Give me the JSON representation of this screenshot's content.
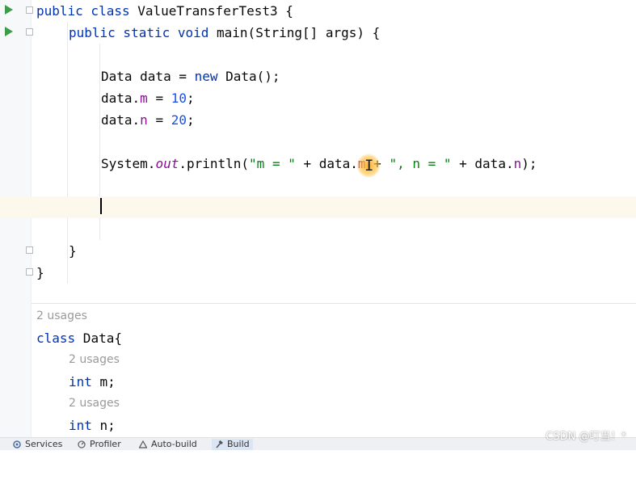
{
  "editor": {
    "lines": {
      "l1": {
        "kw": "public class",
        "name": " ValueTransferTest3 {"
      },
      "l2": {
        "kw1": "public static void",
        "name": " main(String[] args) {"
      },
      "l4": {
        "type": "Data data = ",
        "kw": "new",
        "rest": " Data();"
      },
      "l5": {
        "obj": "data.",
        "field": "m",
        "eq": " = ",
        "num": "10",
        "end": ";"
      },
      "l6": {
        "obj": "data.",
        "field": "n",
        "eq": " = ",
        "num": "20",
        "end": ";"
      },
      "l8": {
        "pre": "System.",
        "out": "out",
        "mid": ".println(",
        "s1": "\"m = \"",
        "plus1": " + data.",
        "field_m": "m",
        "plus2": " + ",
        "s2": "\", n = \"",
        "plus3": " + data.",
        "field_n": "n",
        "end": ");"
      },
      "l12": {
        "text": "}"
      },
      "l13": {
        "text": "}"
      }
    },
    "class_data": {
      "usages_top": "2 usages",
      "decl_kw": "class",
      "decl_name": " Data{",
      "usages_m": "2 usages",
      "m_kw": "int",
      "m_name": " m;",
      "usages_n": "2 usages",
      "n_kw": "int",
      "n_name": " n;"
    }
  },
  "statusbar": {
    "services": "Services",
    "profiler": "Profiler",
    "autobuild": "Auto-build",
    "build": "Build"
  },
  "watermark": "CSDN @叮当！*",
  "icons": {
    "run": "run-icon",
    "fold": "fold-icon"
  }
}
